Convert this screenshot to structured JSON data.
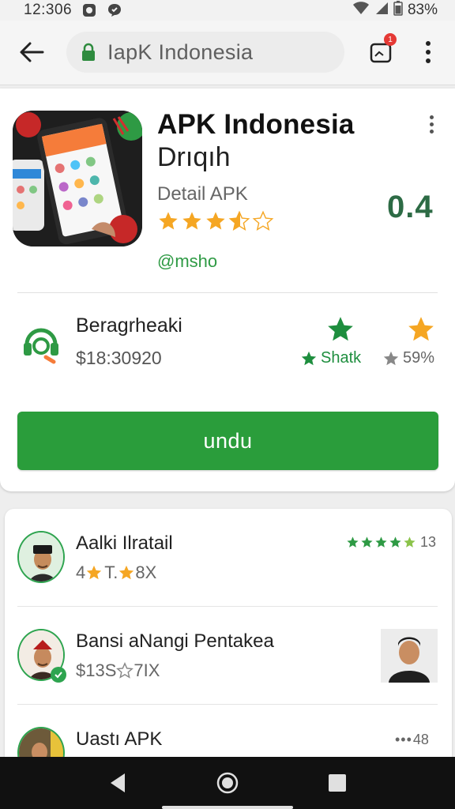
{
  "status_bar": {
    "time": "12:306",
    "battery": "83%"
  },
  "toolbar": {
    "url": "IapK Indonesia",
    "tab_badge": "1"
  },
  "app": {
    "title": "APK Indonesia",
    "subtitle": "Drıqıh",
    "detail": "Detail APK",
    "rating_stars": 3.5,
    "developer": "@msho",
    "version_badge": "0.4"
  },
  "info": {
    "title": "Beragrheaki",
    "size": "$18:30920",
    "share_label": "Shatk",
    "percent_label": "59%"
  },
  "download_button": "undu",
  "reviews": [
    {
      "name": "Aalki Ilratail",
      "meta_prefix": "4",
      "meta_mid": "T.",
      "meta_suffix": "8X",
      "rating_count": "13"
    },
    {
      "name": "Bansi aNangi Pentakea",
      "meta": "$13S",
      "meta_suffix": "7IX"
    },
    {
      "name": "Uastı APK",
      "count": "48"
    }
  ],
  "colors": {
    "accent_green": "#2a9d3b",
    "star_orange": "#f5a623",
    "star_green": "#1e8e3e"
  }
}
